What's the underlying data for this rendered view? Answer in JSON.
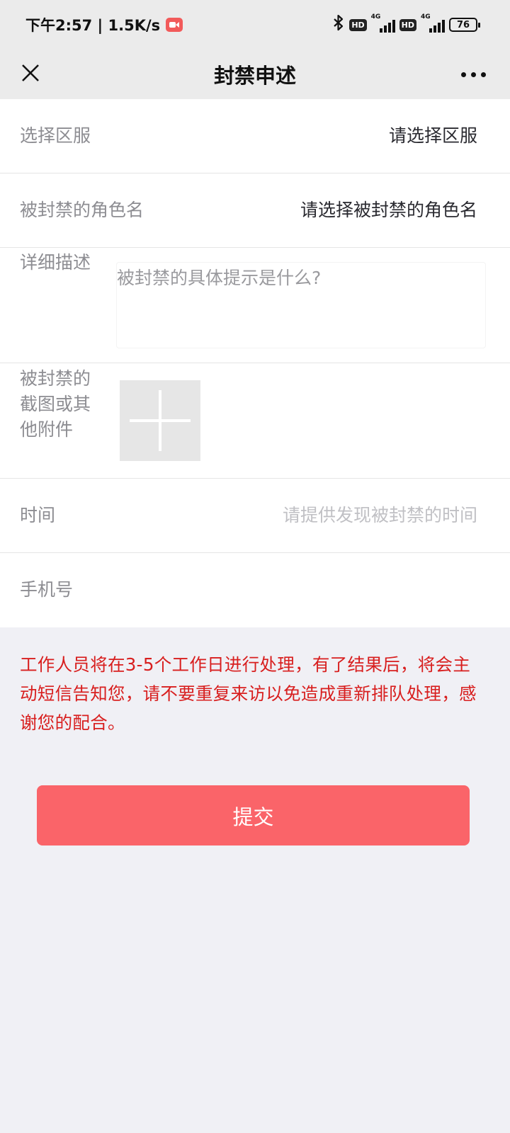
{
  "status_bar": {
    "time_speed": "下午2:57 | 1.5K/s",
    "network": "4G",
    "hd": "HD",
    "battery": "76"
  },
  "nav": {
    "title": "封禁申述"
  },
  "form": {
    "server": {
      "label": "选择区服",
      "value": "请选择区服"
    },
    "role": {
      "label": "被封禁的角色名",
      "value": "请选择被封禁的角色名"
    },
    "description": {
      "label": "详细描述",
      "placeholder": "被封禁的具体提示是什么?"
    },
    "attachment": {
      "label": "被封禁的截图或其他附件"
    },
    "time": {
      "label": "时间",
      "placeholder": "请提供发现被封禁的时间"
    },
    "phone": {
      "label": "手机号",
      "value": ""
    }
  },
  "notice": "工作人员将在3-5个工作日进行处理，有了结果后，将会主动短信告知您，请不要重复来访以免造成重新排队处理，感谢您的配合。",
  "submit_label": "提交",
  "colors": {
    "accent": "#fa6469",
    "notice": "#d81e1e",
    "background": "#f0f0f5"
  }
}
